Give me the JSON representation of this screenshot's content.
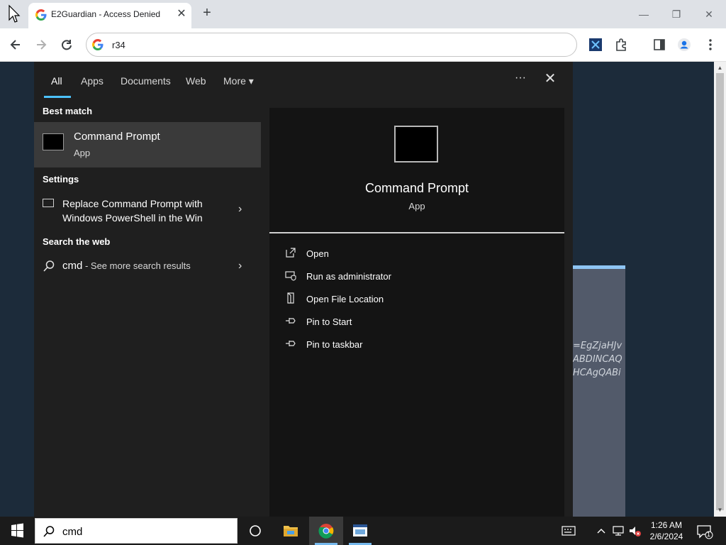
{
  "browser": {
    "tab_title": "E2Guardian - Access Denied",
    "tab_close": "✕",
    "new_tab": "+",
    "url": "r34",
    "window_controls": {
      "minimize": "—",
      "restore": "❐",
      "close": "✕"
    }
  },
  "background_page": {
    "text_lines": [
      "=EgZjaHJv",
      "ABDINCAQ",
      "HCAgQABi"
    ]
  },
  "search_panel": {
    "tabs": [
      {
        "label": "All",
        "active": true
      },
      {
        "label": "Apps"
      },
      {
        "label": "Documents"
      },
      {
        "label": "Web"
      },
      {
        "label": "More"
      }
    ],
    "more_caret": "▾",
    "overflow_label": "···",
    "close_label": "✕",
    "best_match_header": "Best match",
    "best_match": {
      "title": "Command Prompt",
      "subtitle": "App"
    },
    "settings_header": "Settings",
    "settings_item": "Replace Command Prompt with Windows PowerShell in the Win",
    "web_header": "Search the web",
    "web_item": {
      "query": "cmd",
      "suffix": " - See more search results"
    },
    "chevron": "›",
    "detail": {
      "title": "Command Prompt",
      "subtitle": "App",
      "actions": [
        {
          "label": "Open",
          "icon": "open-icon"
        },
        {
          "label": "Run as administrator",
          "icon": "shield-icon"
        },
        {
          "label": "Open File Location",
          "icon": "file-location-icon"
        },
        {
          "label": "Pin to Start",
          "icon": "pin-icon"
        },
        {
          "label": "Pin to taskbar",
          "icon": "pin-icon"
        }
      ]
    }
  },
  "taskbar": {
    "search_value": "cmd",
    "time": "1:26 AM",
    "date": "2/6/2024",
    "notification_count": "1"
  },
  "colors": {
    "accent": "#4cc2ff",
    "panel_bg": "#1f1f1f",
    "detail_bg": "#141414",
    "taskbar_bg": "#1b1b1b"
  }
}
